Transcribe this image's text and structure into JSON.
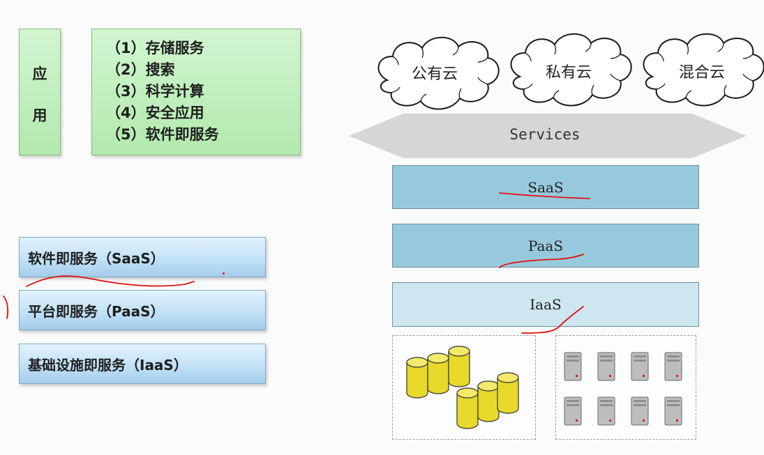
{
  "left": {
    "app_label_1": "应",
    "app_label_2": "用",
    "applications": [
      "（1）存储服务",
      "（2）搜索",
      "（3）科学计算",
      "（4）安全应用",
      "（5）软件即服务"
    ],
    "service_models": [
      "软件即服务（SaaS）",
      "平台即服务（PaaS）",
      "基础设施即服务（IaaS）"
    ]
  },
  "right": {
    "clouds": [
      "公有云",
      "私有云",
      "混合云"
    ],
    "services_label": "Services",
    "layers": [
      "SaaS",
      "PaaS",
      "IaaS"
    ]
  },
  "colors": {
    "green_fill": "#b2e9ae",
    "blue_fill": "#a4cdea",
    "layer_fill": "#97c9dd",
    "iaas_fill": "#cde6ef",
    "arrow_fill": "#d6d6d6",
    "annotation_red": "#e01010",
    "db_yellow": "#e8d92a",
    "server_gray": "#b9b9b9"
  }
}
